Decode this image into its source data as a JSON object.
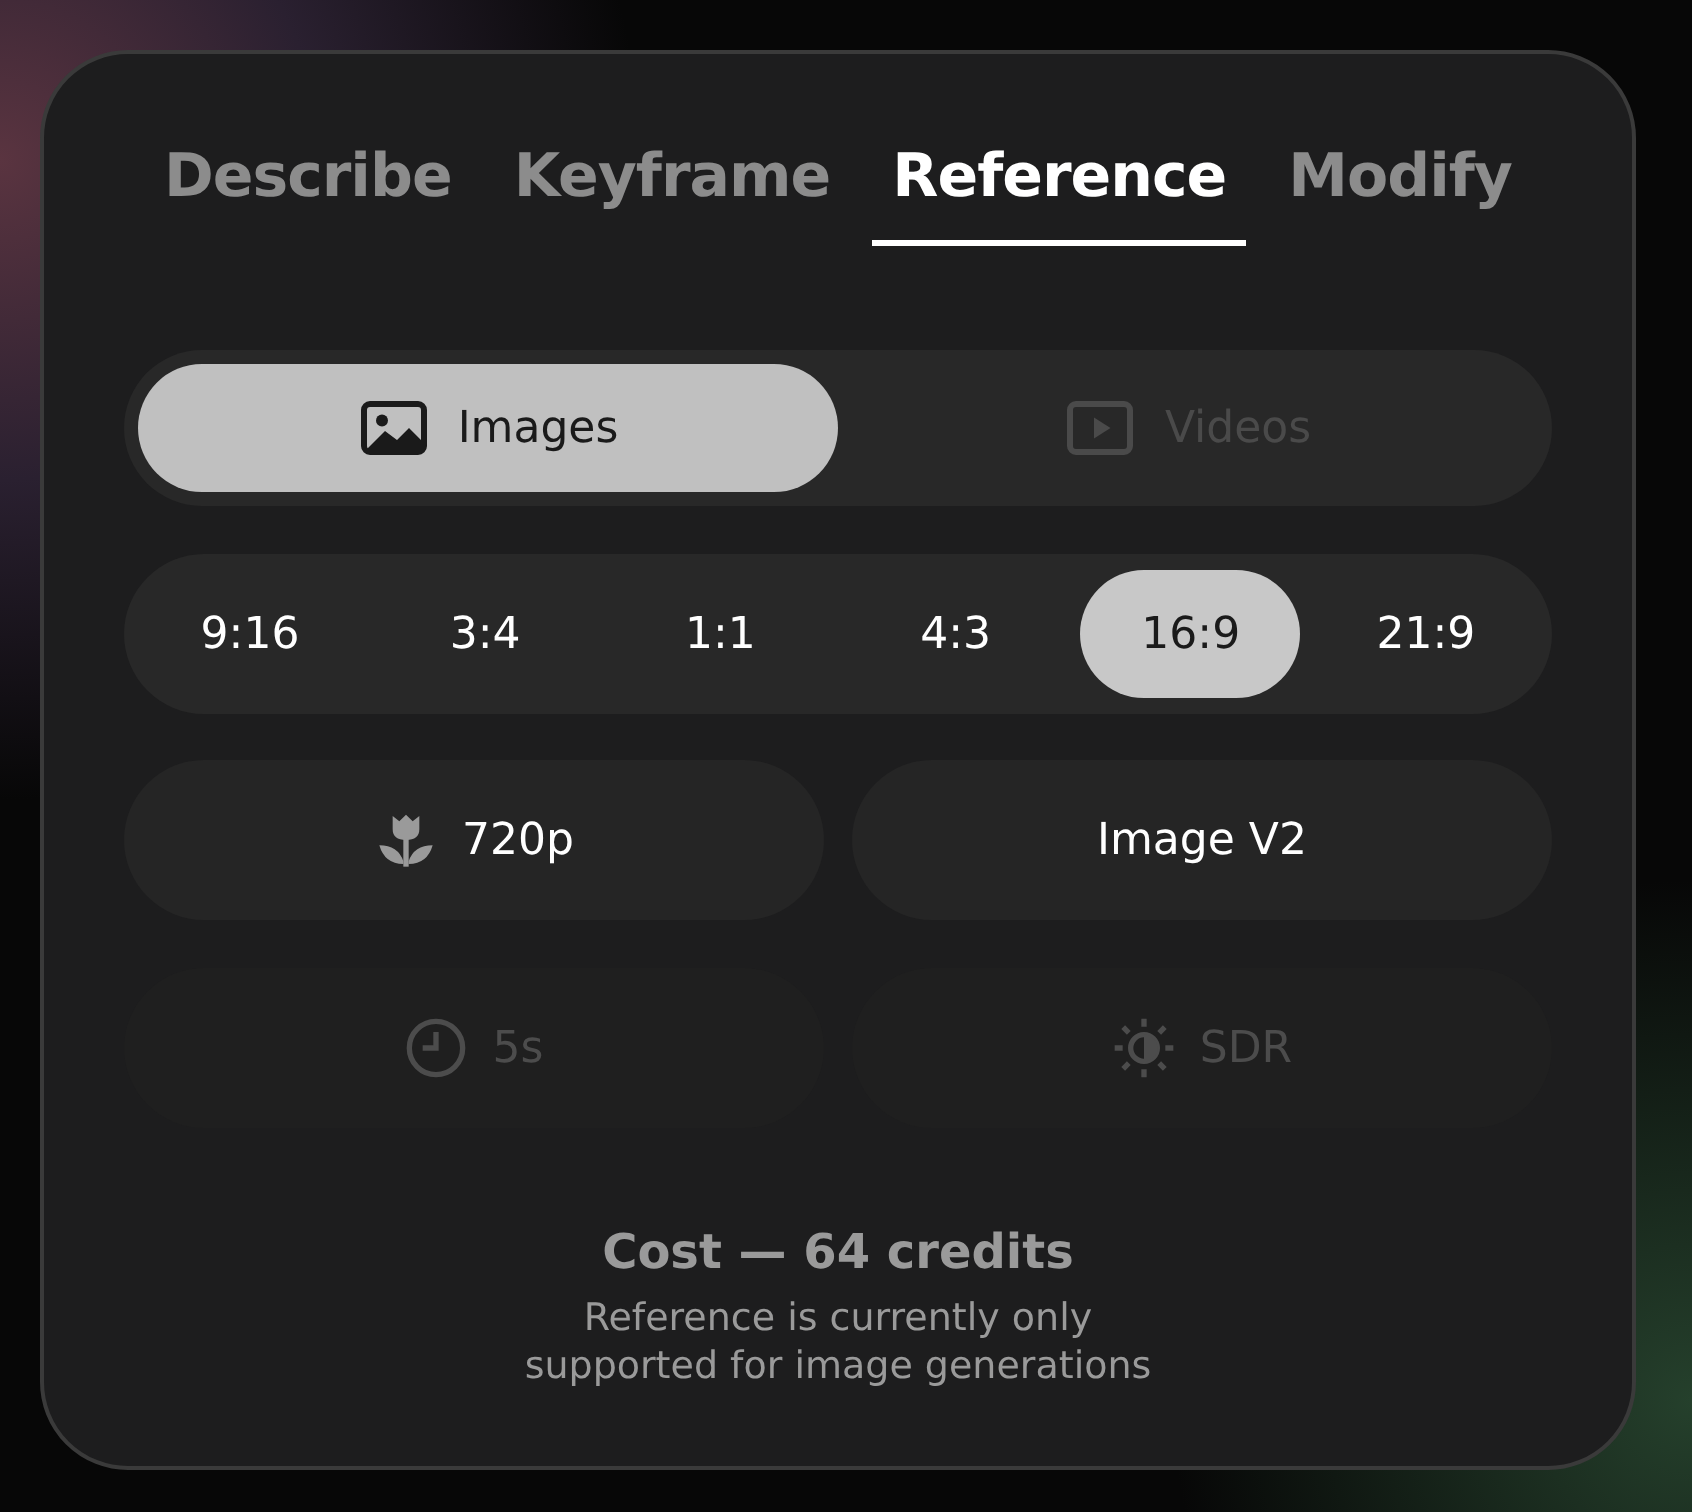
{
  "tabs": [
    {
      "label": "Describe",
      "selected": false
    },
    {
      "label": "Keyframe",
      "selected": false
    },
    {
      "label": "Reference",
      "selected": true
    },
    {
      "label": "Modify",
      "selected": false
    }
  ],
  "media": [
    {
      "label": "Images",
      "kind": "image",
      "selected": true
    },
    {
      "label": "Videos",
      "kind": "video",
      "selected": false
    }
  ],
  "ratios": [
    {
      "label": "9:16",
      "selected": false
    },
    {
      "label": "3:4",
      "selected": false
    },
    {
      "label": "1:1",
      "selected": false
    },
    {
      "label": "4:3",
      "selected": false
    },
    {
      "label": "16:9",
      "selected": true
    },
    {
      "label": "21:9",
      "selected": false
    }
  ],
  "options": [
    {
      "label": "720p",
      "kind": "tulip",
      "disabled": false
    },
    {
      "label": "Image V2",
      "kind": "plain",
      "disabled": false
    },
    {
      "label": "5s",
      "kind": "clock",
      "disabled": true
    },
    {
      "label": "SDR",
      "kind": "brightness",
      "disabled": true
    }
  ],
  "cost": "Cost — 64 credits",
  "note": "Reference is currently only supported for image generations"
}
